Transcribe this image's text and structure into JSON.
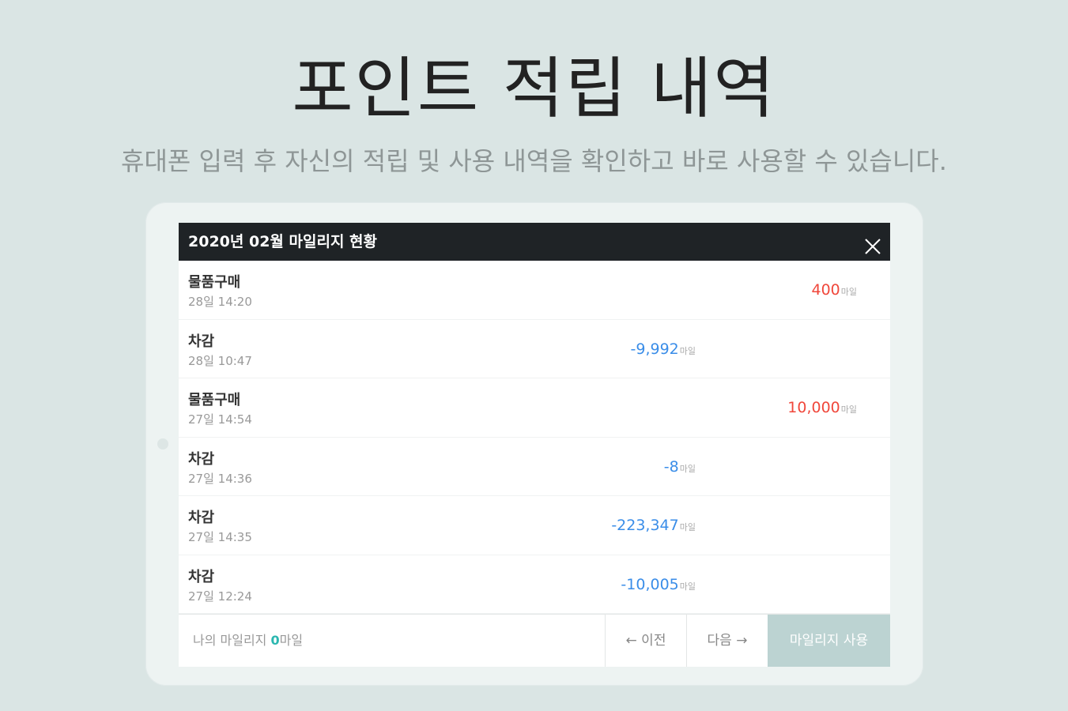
{
  "hero": {
    "title": "포인트 적립 내역",
    "subtitle": "휴대폰 입력 후 자신의 적립 및 사용 내역을 확인하고 바로 사용할 수 있습니다."
  },
  "modal": {
    "title": "2020년 02월 마일리지 현황",
    "close_icon": "close-icon"
  },
  "rows": [
    {
      "label": "물품구매",
      "date": "28일 14:20",
      "amount": "400",
      "unit": "마일",
      "kind": "earn"
    },
    {
      "label": "차감",
      "date": "28일 10:47",
      "amount": "-9,992",
      "unit": "마일",
      "kind": "spend"
    },
    {
      "label": "물품구매",
      "date": "27일 14:54",
      "amount": "10,000",
      "unit": "마일",
      "kind": "earn"
    },
    {
      "label": "차감",
      "date": "27일 14:36",
      "amount": "-8",
      "unit": "마일",
      "kind": "spend"
    },
    {
      "label": "차감",
      "date": "27일 14:35",
      "amount": "-223,347",
      "unit": "마일",
      "kind": "spend"
    },
    {
      "label": "차감",
      "date": "27일 12:24",
      "amount": "-10,005",
      "unit": "마일",
      "kind": "spend"
    }
  ],
  "footer": {
    "balance_label": "나의 마일리지 ",
    "balance_value": "0",
    "balance_unit": "마일",
    "prev_label": "← 이전",
    "next_label": "다음 →",
    "use_label": "마일리지 사용"
  },
  "colors": {
    "earn": "#f0473b",
    "spend": "#3a8de8",
    "accent": "#2bb7b0",
    "header": "#1f2326"
  }
}
